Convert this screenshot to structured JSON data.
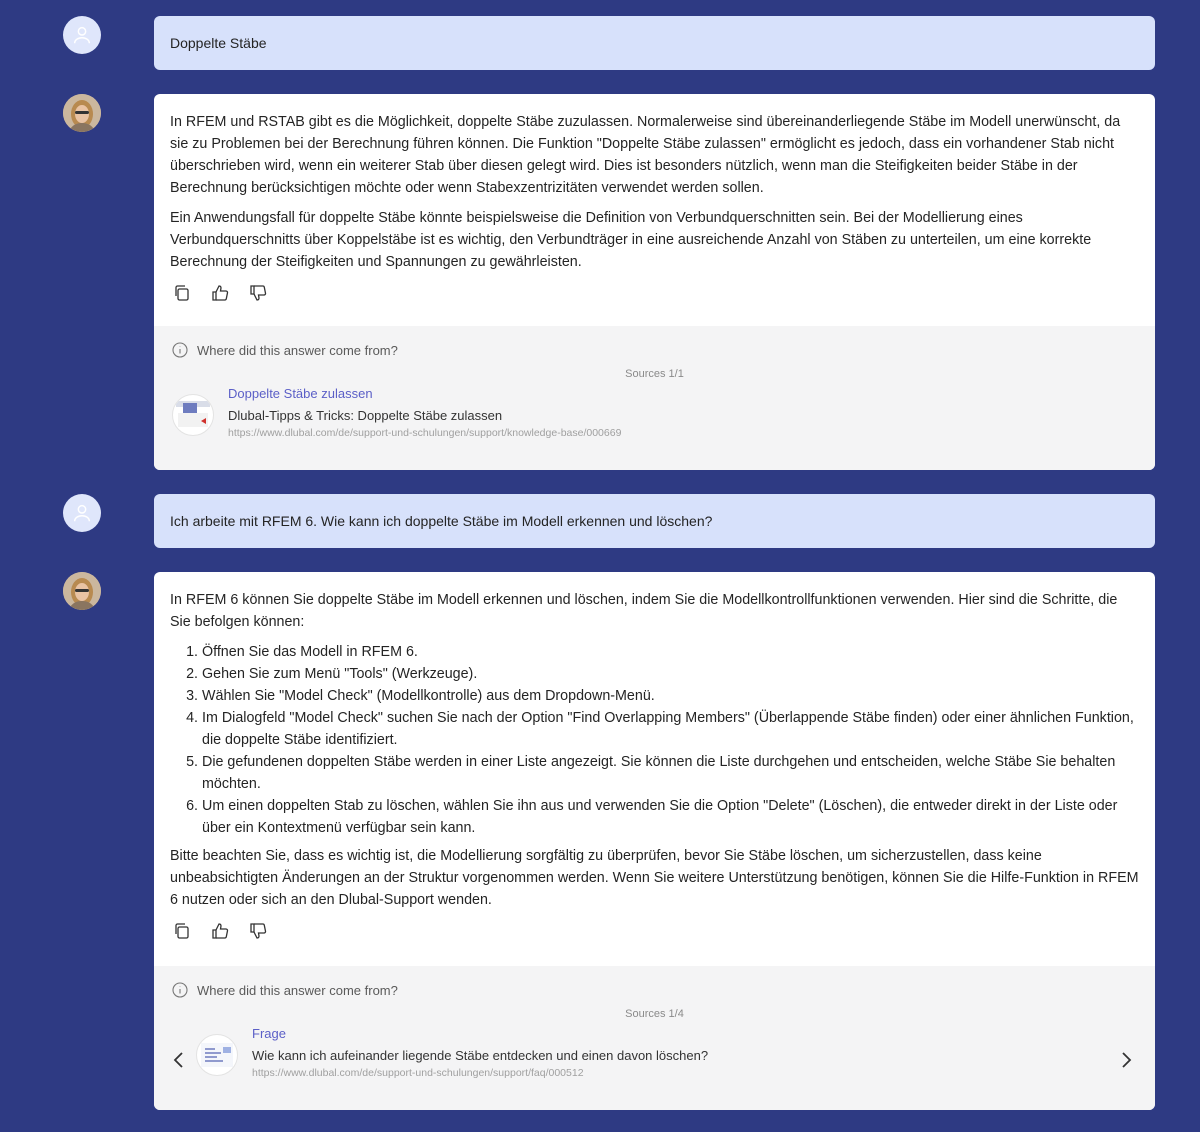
{
  "conversation": {
    "q1": "Doppelte Stäbe",
    "a1": {
      "paragraphs": [
        "In RFEM und RSTAB gibt es die Möglichkeit, doppelte Stäbe zuzulassen. Normalerweise sind übereinanderliegende Stäbe im Modell unerwünscht, da sie zu Problemen bei der Berechnung führen können. Die Funktion \"Doppelte Stäbe zulassen\" ermöglicht es jedoch, dass ein vorhandener Stab nicht überschrieben wird, wenn ein weiterer Stab über diesen gelegt wird. Dies ist besonders nützlich, wenn man die Steifigkeiten beider Stäbe in der Berechnung berücksichtigen möchte oder wenn Stabexzentrizitäten verwendet werden sollen.",
        "Ein Anwendungsfall für doppelte Stäbe könnte beispielsweise die Definition von Verbundquerschnitten sein. Bei der Modellierung eines Verbundquerschnitts über Koppelstäbe ist es wichtig, den Verbundträger in eine ausreichende Anzahl von Stäben zu unterteilen, um eine korrekte Berechnung der Steifigkeiten und Spannungen zu gewährleisten."
      ],
      "sources": {
        "header": "Where did this answer come from?",
        "count": "Sources 1/1",
        "title": "Doppelte Stäbe zulassen",
        "desc": "Dlubal-Tipps & Tricks: Doppelte Stäbe zulassen",
        "url": "https://www.dlubal.com/de/support-und-schulungen/support/knowledge-base/000669"
      }
    },
    "q2": "Ich arbeite mit RFEM 6. Wie kann ich doppelte Stäbe im Modell erkennen und löschen?",
    "a2": {
      "intro": "In RFEM 6 können Sie doppelte Stäbe im Modell erkennen und löschen, indem Sie die Modellkontrollfunktionen verwenden. Hier sind die Schritte, die Sie befolgen können:",
      "steps": [
        "Öffnen Sie das Modell in RFEM 6.",
        "Gehen Sie zum Menü \"Tools\" (Werkzeuge).",
        "Wählen Sie \"Model Check\" (Modellkontrolle) aus dem Dropdown-Menü.",
        "Im Dialogfeld \"Model Check\" suchen Sie nach der Option \"Find Overlapping Members\" (Überlappende Stäbe finden) oder einer ähnlichen Funktion, die doppelte Stäbe identifiziert.",
        "Die gefundenen doppelten Stäbe werden in einer Liste angezeigt. Sie können die Liste durchgehen und entscheiden, welche Stäbe Sie behalten möchten.",
        "Um einen doppelten Stab zu löschen, wählen Sie ihn aus und verwenden Sie die Option \"Delete\" (Löschen), die entweder direkt in der Liste oder über ein Kontextmenü verfügbar sein kann."
      ],
      "outro": "Bitte beachten Sie, dass es wichtig ist, die Modellierung sorgfältig zu überprüfen, bevor Sie Stäbe löschen, um sicherzustellen, dass keine unbeabsichtigten Änderungen an der Struktur vorgenommen werden. Wenn Sie weitere Unterstützung benötigen, können Sie die Hilfe-Funktion in RFEM 6 nutzen oder sich an den Dlubal-Support wenden.",
      "sources": {
        "header": "Where did this answer come from?",
        "count": "Sources 1/4",
        "title": "Frage",
        "desc": "Wie kann ich aufeinander liegende Stäbe entdecken und einen davon löschen?",
        "url": "https://www.dlubal.com/de/support-und-schulungen/support/faq/000512"
      }
    }
  },
  "icons": {
    "user": "user-icon",
    "copy": "copy-icon",
    "like": "thumbs-up-icon",
    "dislike": "thumbs-down-icon",
    "info": "info-icon",
    "prev": "chevron-left-icon",
    "next": "chevron-right-icon"
  },
  "colors": {
    "background": "#2e3a83",
    "question_bubble": "#d7e1fb",
    "link": "#5b5fc7"
  }
}
